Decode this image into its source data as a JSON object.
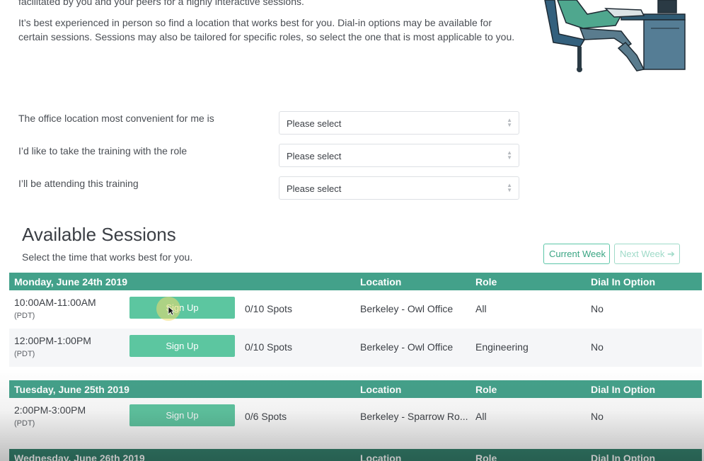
{
  "intro": {
    "line1": "facilitated by you and your peers for a highly interactive sessions.",
    "line2": "It’s best experienced in person so find a location that works best for you. Dial-in options may be available for certain sessions. Sessions may also be tailored for specific roles, so select the one that is most applicable to you."
  },
  "form": {
    "fields": [
      {
        "label": "The office location most convenient for me is",
        "value": "Please select"
      },
      {
        "label": "I’d like to take the training with the role",
        "value": "Please select"
      },
      {
        "label": "I’ll be attending this training",
        "value": "Please select"
      }
    ]
  },
  "sessions": {
    "title": "Available Sessions",
    "subtitle": "Select the time that works best for you.",
    "current_week": "Current Week",
    "next_week": "Next Week",
    "columns": {
      "location": "Location",
      "role": "Role",
      "dial_in": "Dial In Option"
    },
    "days": [
      {
        "date": "Monday, June 24th 2019",
        "rows": [
          {
            "time": "10:00AM-11:00AM",
            "tz": "(PDT)",
            "action": "Sign Up",
            "spots": "0/10 Spots",
            "location": "Berkeley - Owl Office",
            "role": "All",
            "dial_in": "No"
          },
          {
            "time": "12:00PM-1:00PM",
            "tz": "(PDT)",
            "action": "Sign Up",
            "spots": "0/10 Spots",
            "location": "Berkeley - Owl Office",
            "role": "Engineering",
            "dial_in": "No"
          }
        ]
      },
      {
        "date": "Tuesday, June 25th 2019",
        "rows": [
          {
            "time": "2:00PM-3:00PM",
            "tz": "(PDT)",
            "action": "Sign Up",
            "spots": "0/6 Spots",
            "location": "Berkeley - Sparrow Ro...",
            "role": "All",
            "dial_in": "No"
          }
        ]
      },
      {
        "date": "Wednesday, June 26th 2019",
        "rows": []
      }
    ]
  },
  "colors": {
    "accent": "#43a18a",
    "button": "#5cc6a0"
  }
}
